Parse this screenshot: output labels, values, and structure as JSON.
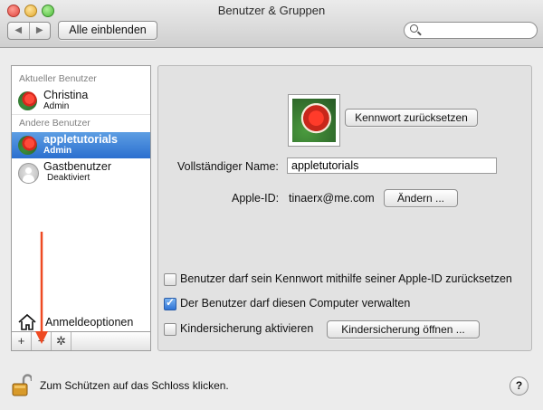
{
  "window": {
    "title": "Benutzer & Gruppen"
  },
  "toolbar": {
    "show_all_label": "Alle einblenden",
    "back_icon": "◀",
    "forward_icon": "▶",
    "search_placeholder": "",
    "search_value": ""
  },
  "sidebar": {
    "current_user_header": "Aktueller Benutzer",
    "other_users_header": "Andere Benutzer",
    "users": [
      {
        "name": "Christina",
        "role": "Admin",
        "avatar": "parrot-avatar",
        "selected": false
      },
      {
        "name": "appletutorials",
        "role": "Admin",
        "avatar": "parrot-avatar",
        "selected": true
      },
      {
        "name": "Gastbenutzer",
        "role": "Deaktiviert",
        "avatar": "guest-avatar",
        "selected": false
      }
    ],
    "login_options_label": "Anmeldeoptionen",
    "add_label": "+",
    "remove_label": "−",
    "gear_label": "✲"
  },
  "main": {
    "change_password_label": "Kennwort zurücksetzen",
    "full_name_label": "Vollständiger Name:",
    "full_name_value": "appletutorials",
    "apple_id_label": "Apple-ID:",
    "apple_id_value": "tinaerx@me.com",
    "change_button_label": "Ändern ...",
    "checkbox_reset_password_label": "Benutzer darf sein Kennwort mithilfe seiner Apple-ID zurücksetzen",
    "checkbox_reset_password_checked": false,
    "checkbox_admin_label": "Der Benutzer darf diesen Computer verwalten",
    "checkbox_admin_checked": true,
    "checkbox_parental_label": "Kindersicherung aktivieren",
    "checkbox_parental_checked": false,
    "open_parental_button_label": "Kindersicherung öffnen ..."
  },
  "footer": {
    "lock_text": "Zum Schützen auf das Schloss klicken.",
    "help_label": "?"
  },
  "colors": {
    "selection": "#2b6fcf",
    "arrow": "#ee4a23"
  }
}
